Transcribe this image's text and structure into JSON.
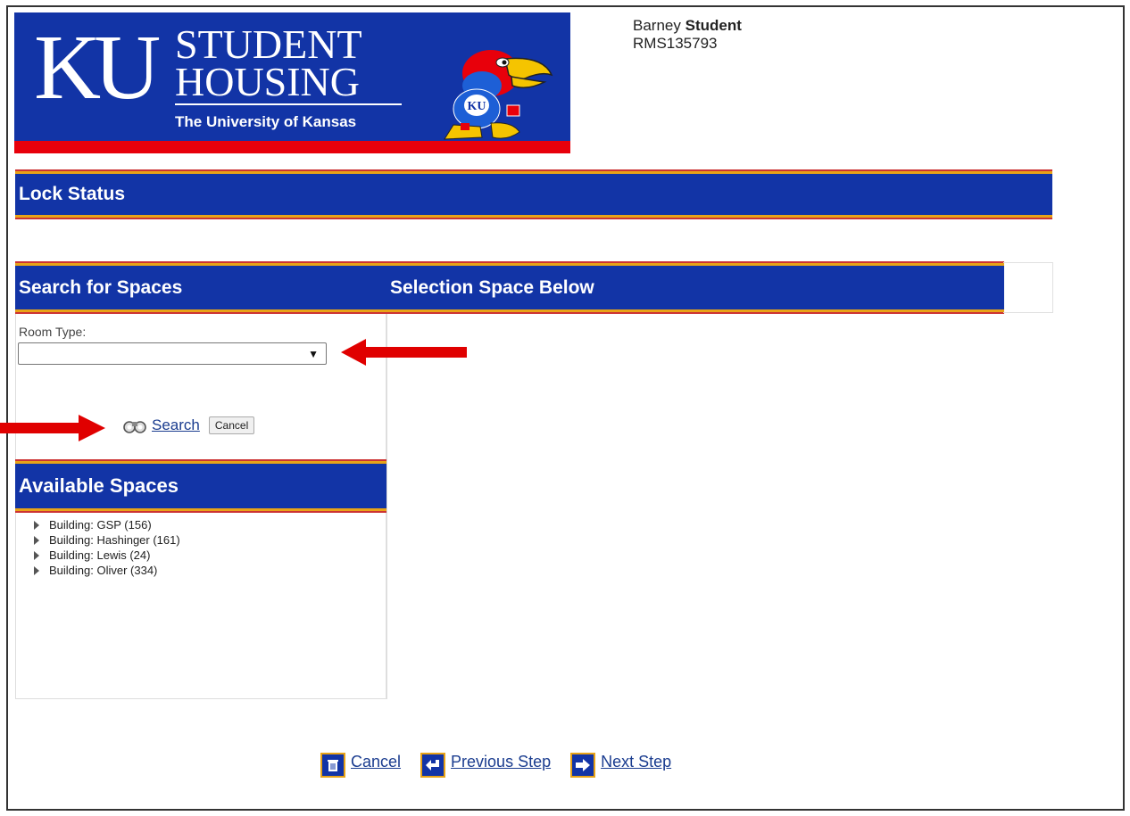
{
  "banner": {
    "ku": "KU",
    "line1": "STUDENT",
    "line2": "HOUSING",
    "university": "The University of Kansas",
    "mascot_icon": "jayhawk-mascot",
    "mascot_badge": "KU"
  },
  "user": {
    "first_name": "Barney",
    "last_name": "Student",
    "id": "RMS135793"
  },
  "page": {
    "title": "Lock Status"
  },
  "search_panel": {
    "title": "Search for Spaces",
    "room_type_label": "Room Type:",
    "room_type_value": "",
    "search_label": "Search",
    "search_icon": "binoculars-icon",
    "cancel_label": "Cancel"
  },
  "selection_panel": {
    "title": "Selection Space Below"
  },
  "available_spaces": {
    "title": "Available Spaces",
    "items": [
      "Building: GSP (156)",
      "Building: Hashinger (161)",
      "Building: Lewis (24)",
      "Building: Oliver (334)"
    ]
  },
  "footer": {
    "cancel_label": "Cancel",
    "previous_label": "Previous Step",
    "next_label": "Next Step"
  },
  "colors": {
    "brand_blue": "#1234a6",
    "brand_red": "#e8000b",
    "accent_gold": "#e8a317",
    "annotation_red": "#e00000",
    "link": "#1a3c8f"
  }
}
